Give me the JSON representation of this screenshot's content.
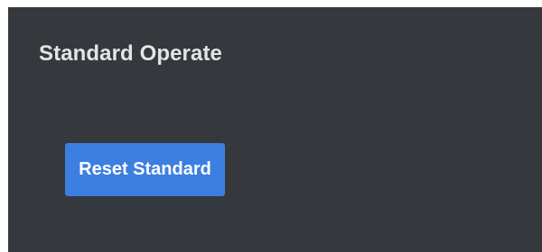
{
  "panel": {
    "title": "Standard Operate",
    "reset_button_label": "Reset Standard"
  },
  "colors": {
    "panel_background": "#35383d",
    "title_text": "#e4e4e4",
    "button_background": "#3c7fe0",
    "button_text": "#ffffff"
  }
}
